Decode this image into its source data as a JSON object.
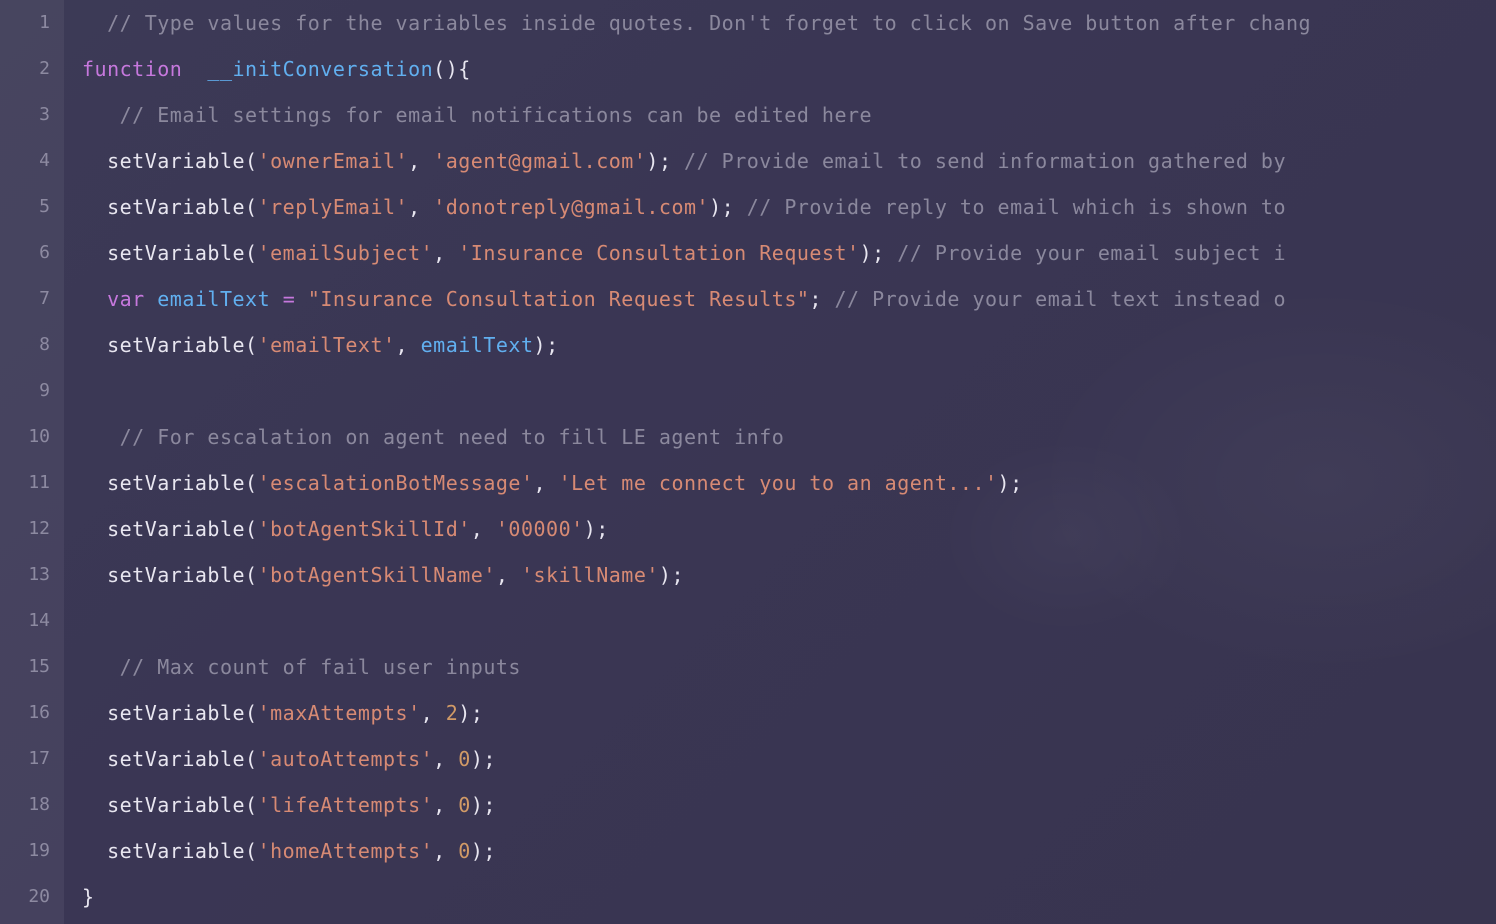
{
  "line_numbers": [
    "1",
    "2",
    "3",
    "4",
    "5",
    "6",
    "7",
    "8",
    "9",
    "10",
    "11",
    "12",
    "13",
    "14",
    "15",
    "16",
    "17",
    "18",
    "19",
    "20"
  ],
  "lines": {
    "l1": {
      "c1": "// Type values for the variables inside quotes. Don't forget to click on Save button after chang"
    },
    "l2": {
      "kw": "function",
      "sp": "  ",
      "fn": "__initConversation",
      "p1": "()",
      "br": "{"
    },
    "l3": {
      "c1": "// Email settings for email notifications can be edited here"
    },
    "l4": {
      "call": "setVariable",
      "po": "(",
      "a1": "'ownerEmail'",
      "cm": ", ",
      "a2": "'agent@gmail.com'",
      "pc": ")",
      "sc": ";",
      "tail": " // Provide email to send information gathered by"
    },
    "l5": {
      "call": "setVariable",
      "po": "(",
      "a1": "'replyEmail'",
      "cm": ", ",
      "a2": "'donotreply@gmail.com'",
      "pc": ")",
      "sc": ";",
      "tail": " // Provide reply to email which is shown to"
    },
    "l6": {
      "call": "setVariable",
      "po": "(",
      "a1": "'emailSubject'",
      "cm": ", ",
      "a2": "'Insurance Consultation Request'",
      "pc": ")",
      "sc": ";",
      "tail": " // Provide your email subject i"
    },
    "l7": {
      "kw": "var",
      "sp": " ",
      "name": "emailText",
      "sp2": " ",
      "op": "=",
      "sp3": " ",
      "str": "\"Insurance Consultation Request Results\"",
      "sc": ";",
      "tail": " // Provide your email text instead o"
    },
    "l8": {
      "call": "setVariable",
      "po": "(",
      "a1": "'emailText'",
      "cm": ", ",
      "v": "emailText",
      "pc": ")",
      "sc": ";"
    },
    "l10": {
      "c1": "// For escalation on agent need to fill LE agent info"
    },
    "l11": {
      "call": "setVariable",
      "po": "(",
      "a1": "'escalationBotMessage'",
      "cm": ", ",
      "a2": "'Let me connect you to an agent...'",
      "pc": ")",
      "sc": ";"
    },
    "l12": {
      "call": "setVariable",
      "po": "(",
      "a1": "'botAgentSkillId'",
      "cm": ", ",
      "a2": "'00000'",
      "pc": ")",
      "sc": ";"
    },
    "l13": {
      "call": "setVariable",
      "po": "(",
      "a1": "'botAgentSkillName'",
      "cm": ", ",
      "a2": "'skillName'",
      "pc": ")",
      "sc": ";"
    },
    "l15": {
      "c1": "// Max count of fail user inputs"
    },
    "l16": {
      "call": "setVariable",
      "po": "(",
      "a1": "'maxAttempts'",
      "cm": ", ",
      "n": "2",
      "pc": ")",
      "sc": ";"
    },
    "l17": {
      "call": "setVariable",
      "po": "(",
      "a1": "'autoAttempts'",
      "cm": ", ",
      "n": "0",
      "pc": ")",
      "sc": ";"
    },
    "l18": {
      "call": "setVariable",
      "po": "(",
      "a1": "'lifeAttempts'",
      "cm": ", ",
      "n": "0",
      "pc": ")",
      "sc": ";"
    },
    "l19": {
      "call": "setVariable",
      "po": "(",
      "a1": "'homeAttempts'",
      "cm": ", ",
      "n": "0",
      "pc": ")",
      "sc": ";"
    },
    "l20": {
      "br": "}"
    }
  },
  "indent1": "  ",
  "indent2": "   "
}
